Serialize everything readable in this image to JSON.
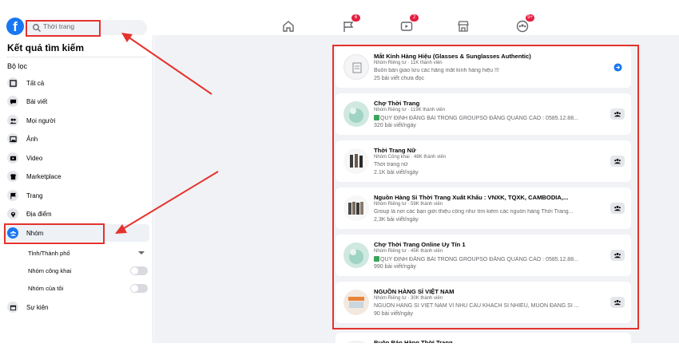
{
  "header": {
    "search_value": "Thời trang",
    "nav": [
      {
        "name": "home",
        "badge": ""
      },
      {
        "name": "pages",
        "badge": "6"
      },
      {
        "name": "watch",
        "badge": "2"
      },
      {
        "name": "marketplace",
        "badge": ""
      },
      {
        "name": "groups",
        "badge": "9+"
      }
    ]
  },
  "sidebar": {
    "title": "Kết quả tìm kiếm",
    "filter_label": "Bộ lọc",
    "items": [
      {
        "label": "Tất cả"
      },
      {
        "label": "Bài viết"
      },
      {
        "label": "Mọi người"
      },
      {
        "label": "Ảnh"
      },
      {
        "label": "Video"
      },
      {
        "label": "Marketplace"
      },
      {
        "label": "Trang"
      },
      {
        "label": "Địa điểm"
      },
      {
        "label": "Nhóm"
      },
      {
        "label": "Sự kiện"
      }
    ],
    "sub_filters": {
      "city": "Tỉnh/Thành phố",
      "public_groups": "Nhóm công khai",
      "my_groups": "Nhóm của tôi"
    }
  },
  "results": [
    {
      "title": "Mắt Kính Hàng Hiệu (Glasses & Sunglasses Authentic)",
      "meta": "Nhóm Riêng tư · 11K thành viên",
      "desc": "Buôn bán giao lưu các hãng mắt kính hàng hiệu !!!",
      "posts": "25 bài viết chưa đọc",
      "verified": false
    },
    {
      "title": "Chợ Thời Trang",
      "meta": "Nhóm Riêng tư · 119K thành viên",
      "desc": "QUY ĐỊNH ĐĂNG BÀI TRONG GROUPSO ĐĂNG QUẢNG CÁO : 0585.12.88...",
      "posts": "320 bài viết/ngày",
      "verified": true
    },
    {
      "title": "Thời Trang Nữ",
      "meta": "Nhóm Công khai · 48K thành viên",
      "desc": "Thời trang nữ",
      "posts": "2.1K bài viết/ngày",
      "verified": false
    },
    {
      "title": "Nguồn Hàng Sỉ Thời Trang Xuất Khẩu : VNXK, TQXK, CAMBODIA,...",
      "meta": "Nhóm Riêng tư · 59K thành viên",
      "desc": "Group là nơi các bạn giới thiệu công như tìm kiếm các nguồn hàng Thời Trang...",
      "posts": "2,3K bài viết/ngày",
      "verified": false
    },
    {
      "title": "Chợ Thời Trang Online Uy Tín 1",
      "meta": "Nhóm Riêng tư · 45K thành viên",
      "desc": "QUY ĐỊNH ĐĂNG BÀI TRONG GROUPSO ĐĂNG QUẢNG CÁO : 0585.12.88...",
      "posts": "990 bài viết/ngày",
      "verified": true
    },
    {
      "title": "NGUỒN HÀNG SỈ VIỆT NAM",
      "meta": "Nhóm Riêng tư · 30K thành viên",
      "desc": "NGUỒN HÀNG SỈ VIỆT NAM VÌ NHU CẦU KHÁCH SỈ NHIỀU, MUỐN ĐĂNG SỈ ...",
      "posts": "90 bài viết/ngày",
      "verified": false
    },
    {
      "title": "Buôn Bán Hàng Thời Trang",
      "meta": "",
      "desc": "",
      "posts": "",
      "verified": false
    }
  ],
  "colors": {
    "accent": "#1877f2",
    "annotation": "#e5322d",
    "background": "#f0f2f5"
  }
}
